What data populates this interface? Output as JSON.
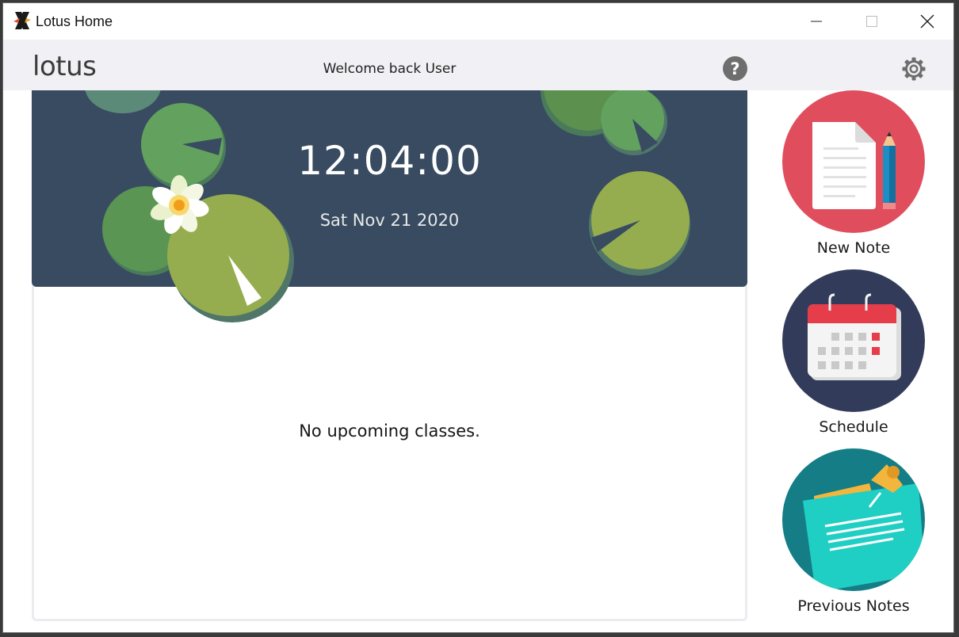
{
  "window": {
    "title": "Lotus Home",
    "controls": {
      "minimize_icon": "minimize-icon",
      "maximize_icon": "maximize-icon",
      "close_icon": "close-icon"
    }
  },
  "header": {
    "brand": "lotus",
    "welcome": "Welcome back User",
    "help_label": "?",
    "help_icon": "help-icon",
    "settings_icon": "gear-icon"
  },
  "banner": {
    "time": "12:04:00",
    "date": "Sat Nov 21 2020",
    "background_color": "#384b61"
  },
  "main": {
    "empty_message": "No upcoming classes."
  },
  "sidebar": {
    "items": [
      {
        "label": "New Note",
        "icon": "new-note-icon",
        "color": "#e04e5e"
      },
      {
        "label": "Schedule",
        "icon": "calendar-icon",
        "color": "#323c5a"
      },
      {
        "label": "Previous Notes",
        "icon": "previous-notes-icon",
        "color": "#147d86"
      }
    ]
  }
}
